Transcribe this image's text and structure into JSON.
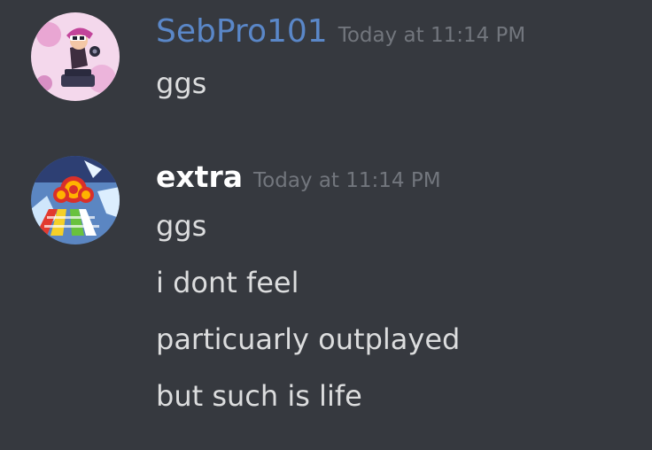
{
  "messages": [
    {
      "author": "SebPro101",
      "timestamp": "Today at 11:14 PM",
      "avatar_icon": "splatoon-inkling-avatar",
      "author_color": "#5a87c8",
      "lines": [
        "ggs"
      ]
    },
    {
      "author": "extra",
      "timestamp": "Today at 11:14 PM",
      "avatar_icon": "rainbow-road-avatar",
      "author_color": "#ffffff",
      "lines": [
        "ggs",
        "i dont feel",
        "particuarly outplayed",
        "but such is life"
      ]
    }
  ],
  "colors": {
    "background": "#36393f",
    "text": "#dcddde",
    "timestamp": "#72767d"
  }
}
